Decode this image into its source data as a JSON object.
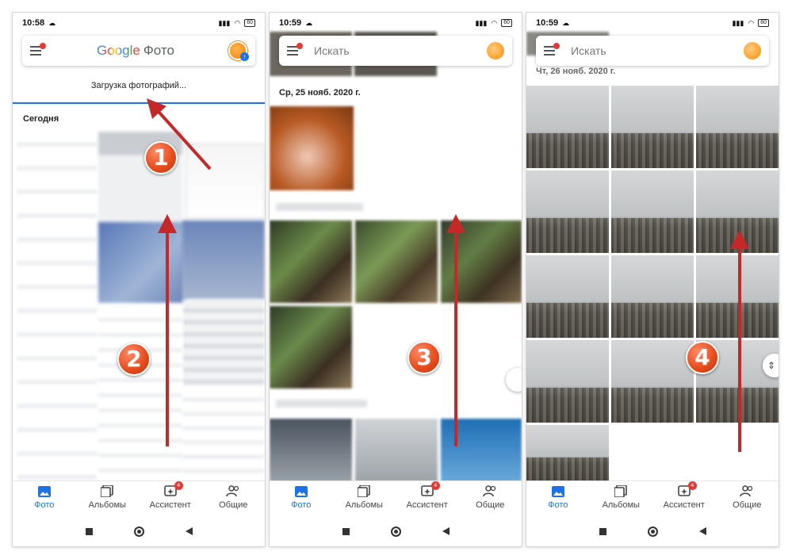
{
  "screens": [
    {
      "status_time": "10:58",
      "app_title_brand": "Google",
      "app_title_suffix": "Фото",
      "upload_text": "Загрузка фотографий...",
      "section_label": "Сегодня"
    },
    {
      "status_time": "10:59",
      "search_placeholder": "Искать",
      "date_label": "Ср, 25 нояб. 2020 г."
    },
    {
      "status_time": "10:59",
      "search_placeholder": "Искать",
      "date_label": "Чт, 26 нояб. 2020 г."
    }
  ],
  "battery_level": "60",
  "bottom_nav": [
    {
      "label": "Фото",
      "icon": "photo-icon",
      "active": true
    },
    {
      "label": "Альбомы",
      "icon": "albums-icon"
    },
    {
      "label": "Ассистент",
      "icon": "assistant-icon",
      "badge": "4"
    },
    {
      "label": "Общие",
      "icon": "shared-icon"
    }
  ],
  "step_markers": [
    "1",
    "2",
    "3",
    "4"
  ],
  "colors": {
    "accent": "#1a73e8",
    "arrow": "#c62828",
    "badge": "#e53935"
  }
}
